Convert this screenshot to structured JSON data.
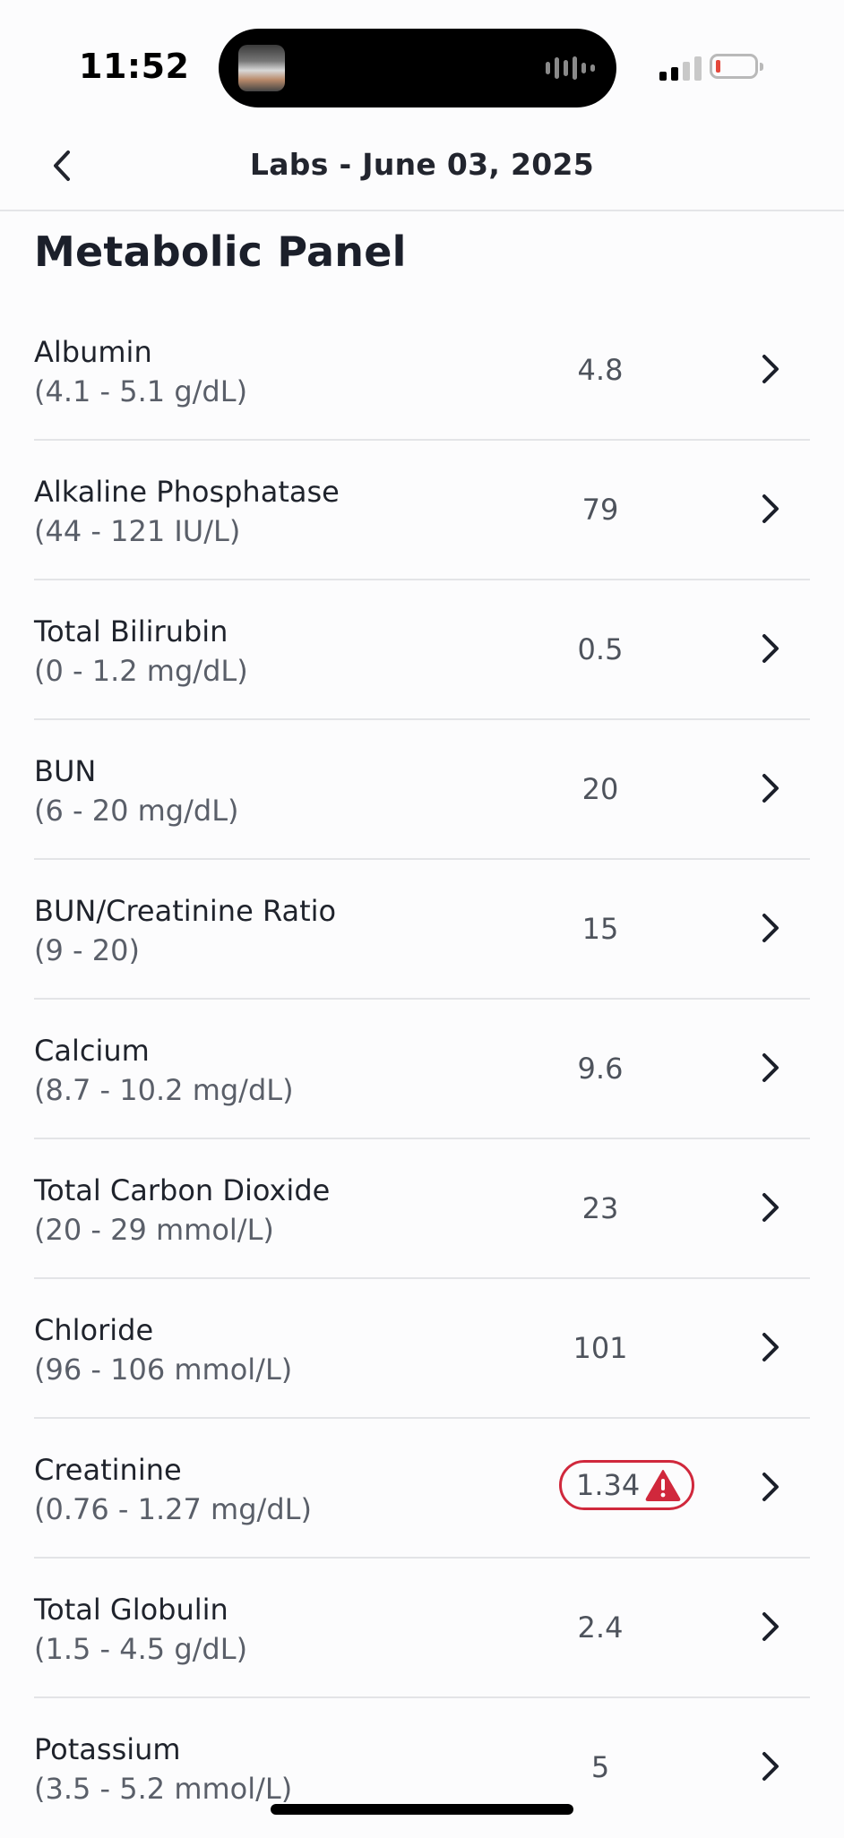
{
  "status_bar": {
    "time": "11:52",
    "battery_level": 0.08,
    "signal_bars_active": 2
  },
  "header": {
    "title": "Labs - June 03, 2025",
    "back_icon": "chevron-left-icon"
  },
  "panel": {
    "title": "Metabolic Panel",
    "items": [
      {
        "name": "Albumin",
        "range": "(4.1 - 5.1 g/dL)",
        "value": "4.8",
        "flagged": false
      },
      {
        "name": "Alkaline Phosphatase",
        "range": "(44 - 121 IU/L)",
        "value": "79",
        "flagged": false
      },
      {
        "name": "Total Bilirubin",
        "range": "(0 - 1.2 mg/dL)",
        "value": "0.5",
        "flagged": false
      },
      {
        "name": "BUN",
        "range": "(6 - 20 mg/dL)",
        "value": "20",
        "flagged": false
      },
      {
        "name": "BUN/Creatinine Ratio",
        "range": "(9 - 20)",
        "value": "15",
        "flagged": false
      },
      {
        "name": "Calcium",
        "range": "(8.7 - 10.2 mg/dL)",
        "value": "9.6",
        "flagged": false
      },
      {
        "name": "Total Carbon Dioxide",
        "range": "(20 - 29 mmol/L)",
        "value": "23",
        "flagged": false
      },
      {
        "name": "Chloride",
        "range": "(96 - 106 mmol/L)",
        "value": "101",
        "flagged": false
      },
      {
        "name": "Creatinine",
        "range": "(0.76 - 1.27 mg/dL)",
        "value": "1.34",
        "flagged": true
      },
      {
        "name": "Total Globulin",
        "range": "(1.5 - 4.5 g/dL)",
        "value": "2.4",
        "flagged": false
      },
      {
        "name": "Potassium",
        "range": "(3.5 - 5.2 mmol/L)",
        "value": "5",
        "flagged": false
      }
    ]
  },
  "colors": {
    "alert": "#d0283c",
    "text_primary": "#1f232c",
    "text_secondary": "#5a5f69",
    "divider": "#e3e4e7"
  },
  "icons": {
    "row_chevron": "chevron-right-icon",
    "alert": "warning-triangle-icon"
  }
}
